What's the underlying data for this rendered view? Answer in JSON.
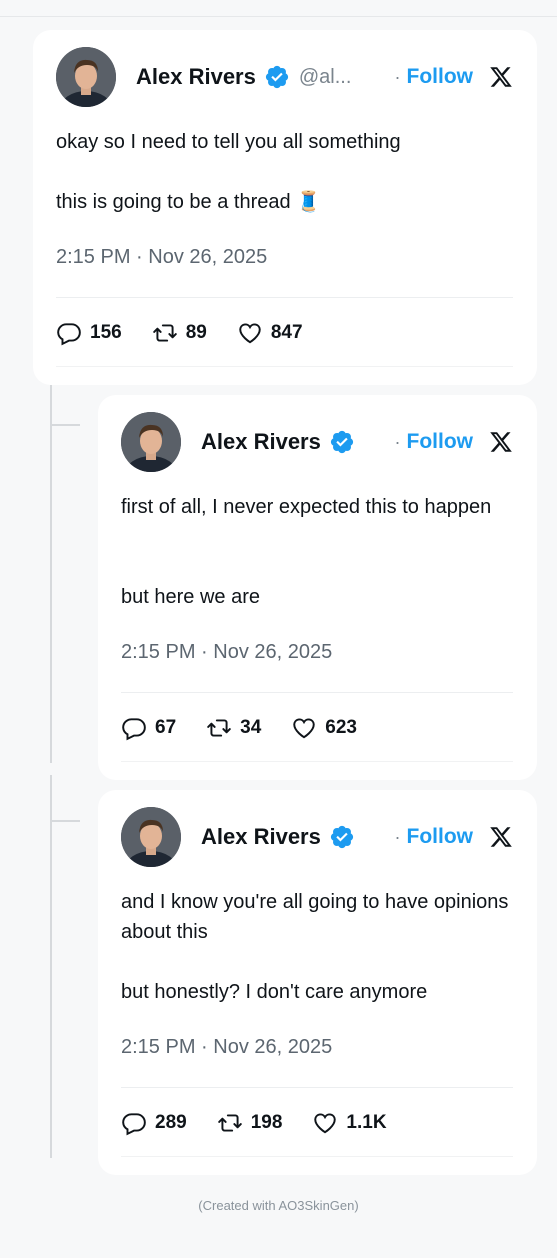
{
  "colors": {
    "background": "#f7f8f9",
    "card": "#ffffff",
    "follow": "#1d9bf0",
    "verified": "#1d9bf0",
    "text": "#0f1419",
    "muted": "#5c6670"
  },
  "tweets": [
    {
      "author": "Alex Rivers",
      "handle": "@al...",
      "dot": "·",
      "follow_label": "Follow",
      "lines": [
        "okay so I need to tell you all something",
        "this is going to be a thread 🧵"
      ],
      "timestamp": "2:15 PM · Nov 26, 2025",
      "replies": "156",
      "retweets": "89",
      "likes": "847"
    },
    {
      "author": "Alex Rivers",
      "dot": "·",
      "follow_label": "Follow",
      "lines": [
        "first of all, I never expected this to happen",
        "but here we are"
      ],
      "timestamp": "2:15 PM · Nov 26, 2025",
      "replies": "67",
      "retweets": "34",
      "likes": "623"
    },
    {
      "author": "Alex Rivers",
      "dot": "·",
      "follow_label": "Follow",
      "lines": [
        "and I know you're all going to have opinions about this",
        "but honestly? I don't care anymore"
      ],
      "timestamp": "2:15 PM · Nov 26, 2025",
      "replies": "289",
      "retweets": "198",
      "likes": "1.1K"
    }
  ],
  "footer": "(Created with AO3SkinGen)"
}
